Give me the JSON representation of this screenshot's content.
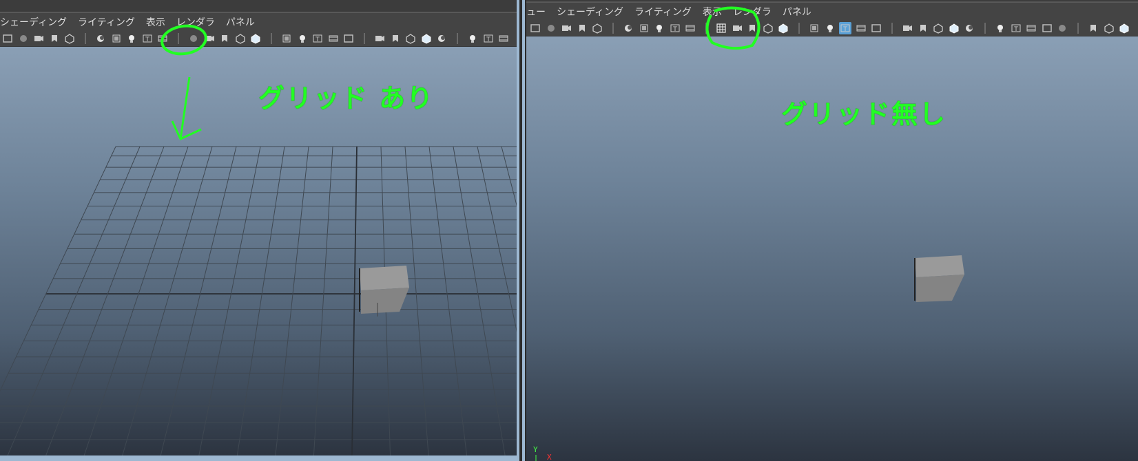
{
  "left_panel": {
    "menu": [
      "シェーディング",
      "ライティング",
      "表示",
      "レンダラ",
      "パネル"
    ],
    "annotation": "グリッド あり",
    "grid_visible": true
  },
  "right_panel": {
    "menu": [
      "ュー",
      "シェーディング",
      "ライティング",
      "表示",
      "レンダラ",
      "パネル"
    ],
    "annotation": "グリッド無し",
    "grid_visible": false,
    "axis": {
      "y": "Y",
      "x": "X"
    }
  },
  "colors": {
    "annotation": "#22ff22",
    "toolbar_active": "#5aa0d6",
    "cube": "#8e8e8e"
  },
  "icons": [
    "grid-toggle-icon",
    "film-gate-icon",
    "camera-icon",
    "wireframe-icon",
    "shaded-icon",
    "light-icon"
  ]
}
